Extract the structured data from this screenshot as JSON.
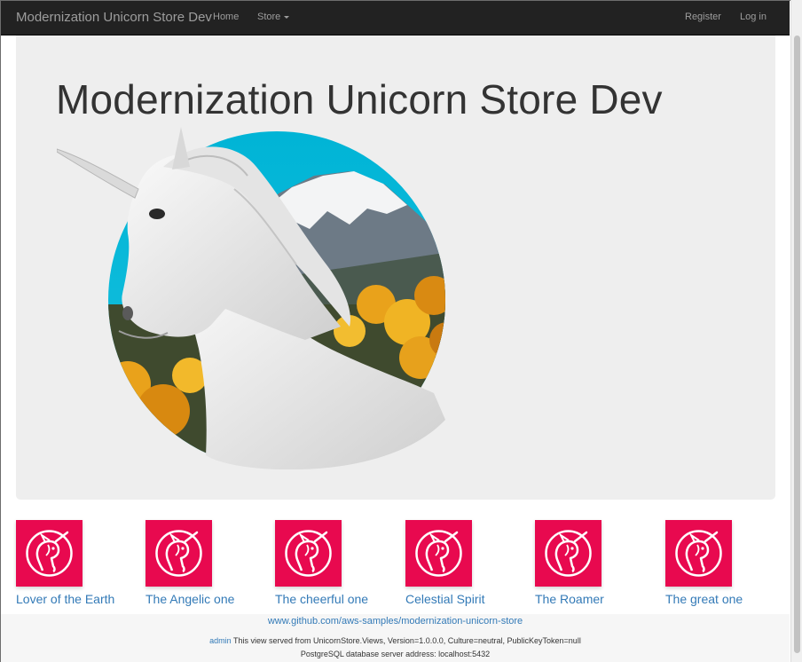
{
  "navbar": {
    "brand": "Modernization Unicorn Store Dev",
    "home": "Home",
    "store": "Store",
    "register": "Register",
    "login": "Log in"
  },
  "hero": {
    "title": "Modernization Unicorn Store Dev"
  },
  "products": [
    {
      "name": "Lover of the Earth"
    },
    {
      "name": "The Angelic one"
    },
    {
      "name": "The cheerful one"
    },
    {
      "name": "Celestial Spirit"
    },
    {
      "name": "The Roamer"
    },
    {
      "name": "The great one"
    }
  ],
  "footer": {
    "repo_link": "www.github.com/aws-samples/modernization-unicorn-store",
    "user": "admin",
    "served_text": "This view served from UnicornStore.Views, Version=1.0.0.0, Culture=neutral, PublicKeyToken=null",
    "db_text": "PostgreSQL database server address: localhost:5432"
  },
  "colors": {
    "navbar": "#222222",
    "jumbotron": "#eeeeee",
    "product_tile": "#e8094f",
    "link": "#337ab7"
  },
  "icons": {
    "product": "unicorn-logo-icon",
    "dropdown": "caret-down-icon"
  }
}
